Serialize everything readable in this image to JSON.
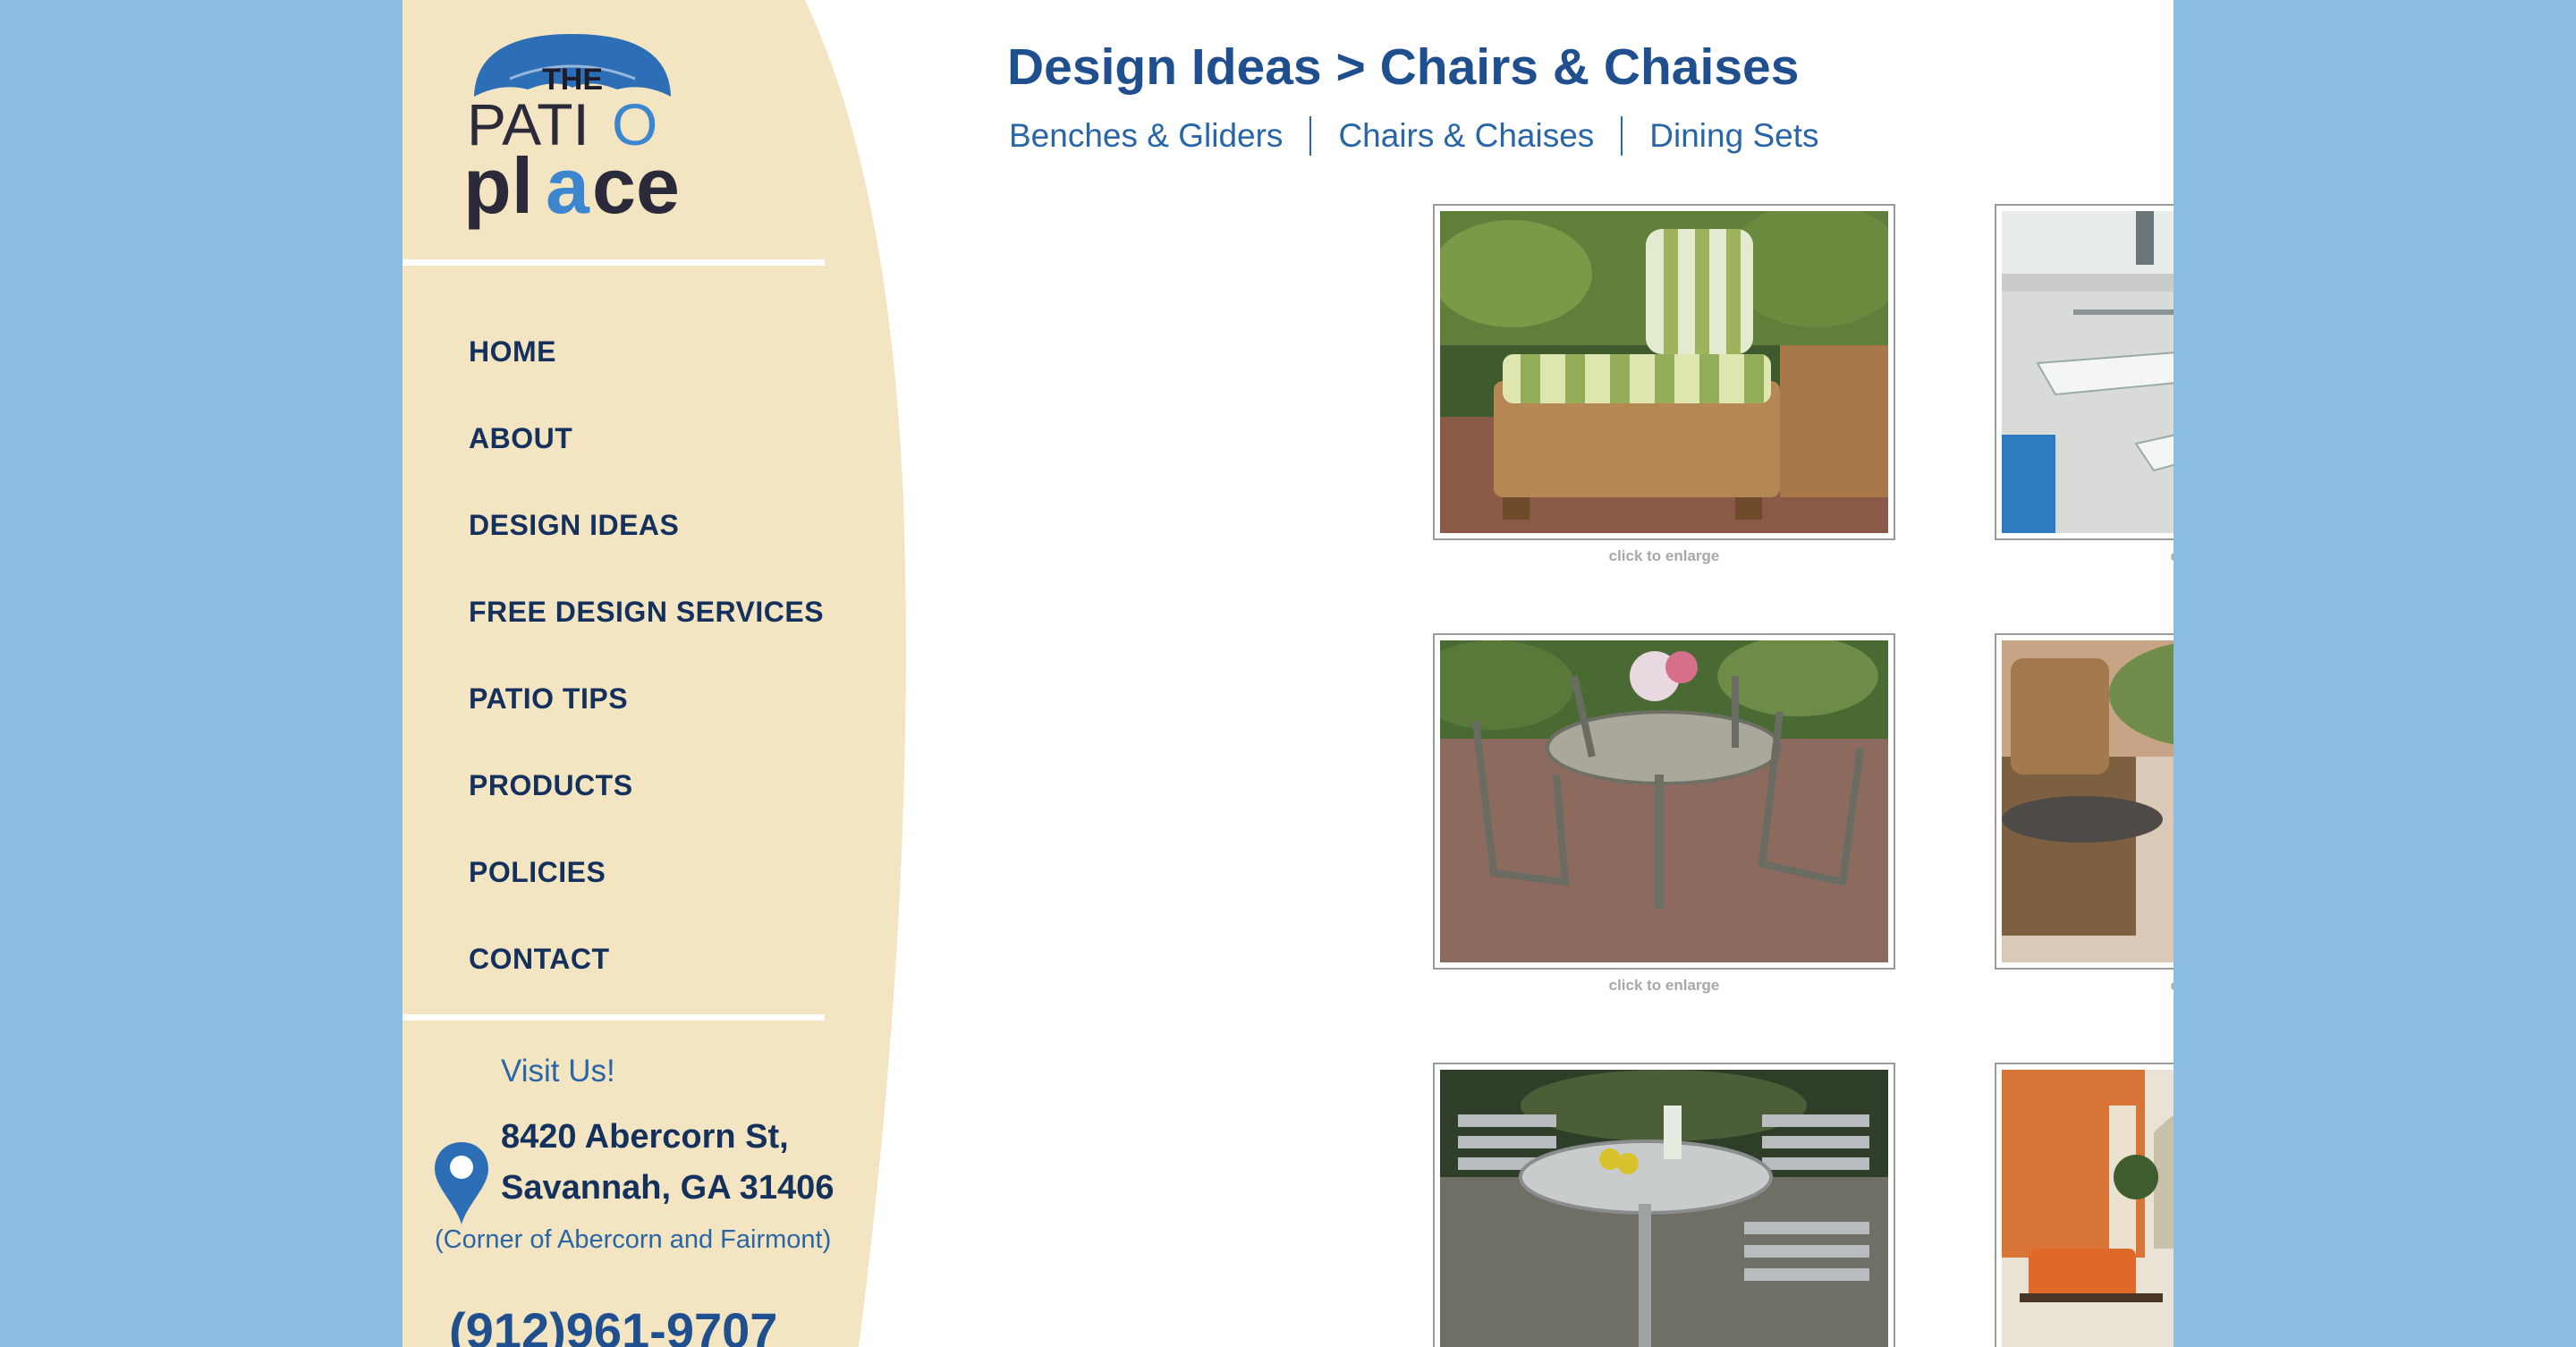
{
  "logo": {
    "the": "THE",
    "patio": "PATI",
    "o_letter": "O",
    "place_pl": "pl",
    "place_a": "a",
    "place_ce": "ce"
  },
  "nav": {
    "items": [
      {
        "label": "HOME"
      },
      {
        "label": "ABOUT"
      },
      {
        "label": "DESIGN IDEAS"
      },
      {
        "label": "FREE DESIGN SERVICES"
      },
      {
        "label": "PATIO TIPS"
      },
      {
        "label": "PRODUCTS"
      },
      {
        "label": "POLICIES"
      },
      {
        "label": "CONTACT"
      }
    ]
  },
  "visit": {
    "heading": "Visit Us!",
    "address_line1": "8420 Abercorn St,",
    "address_line2": "Savannah, GA 31406",
    "corner": "(Corner of Abercorn and Fairmont)",
    "phone": "(912)961-9707",
    "pin_icon": "map-pin-icon"
  },
  "header": {
    "title": "Design Ideas > Chairs & Chaises"
  },
  "subnav": {
    "items": [
      {
        "label": "Benches & Gliders"
      },
      {
        "label": "Chairs & Chaises"
      },
      {
        "label": "Dining Sets"
      }
    ]
  },
  "gallery": {
    "caption": "click to enlarge",
    "images": [
      {
        "subject": "wicker chaise with green striped cushion"
      },
      {
        "subject": "white sling chaise lounges by pool"
      },
      {
        "subject": "metal dining set on brick patio"
      },
      {
        "subject": "brown cushioned lounge chairs"
      },
      {
        "subject": "silver slat dining set"
      },
      {
        "subject": "orange cushioned seating group"
      }
    ]
  },
  "colors": {
    "background": "#8bbde3",
    "sidebar": "#f3e4c2",
    "navy": "#14315e",
    "brand_blue": "#1f4f8e"
  }
}
